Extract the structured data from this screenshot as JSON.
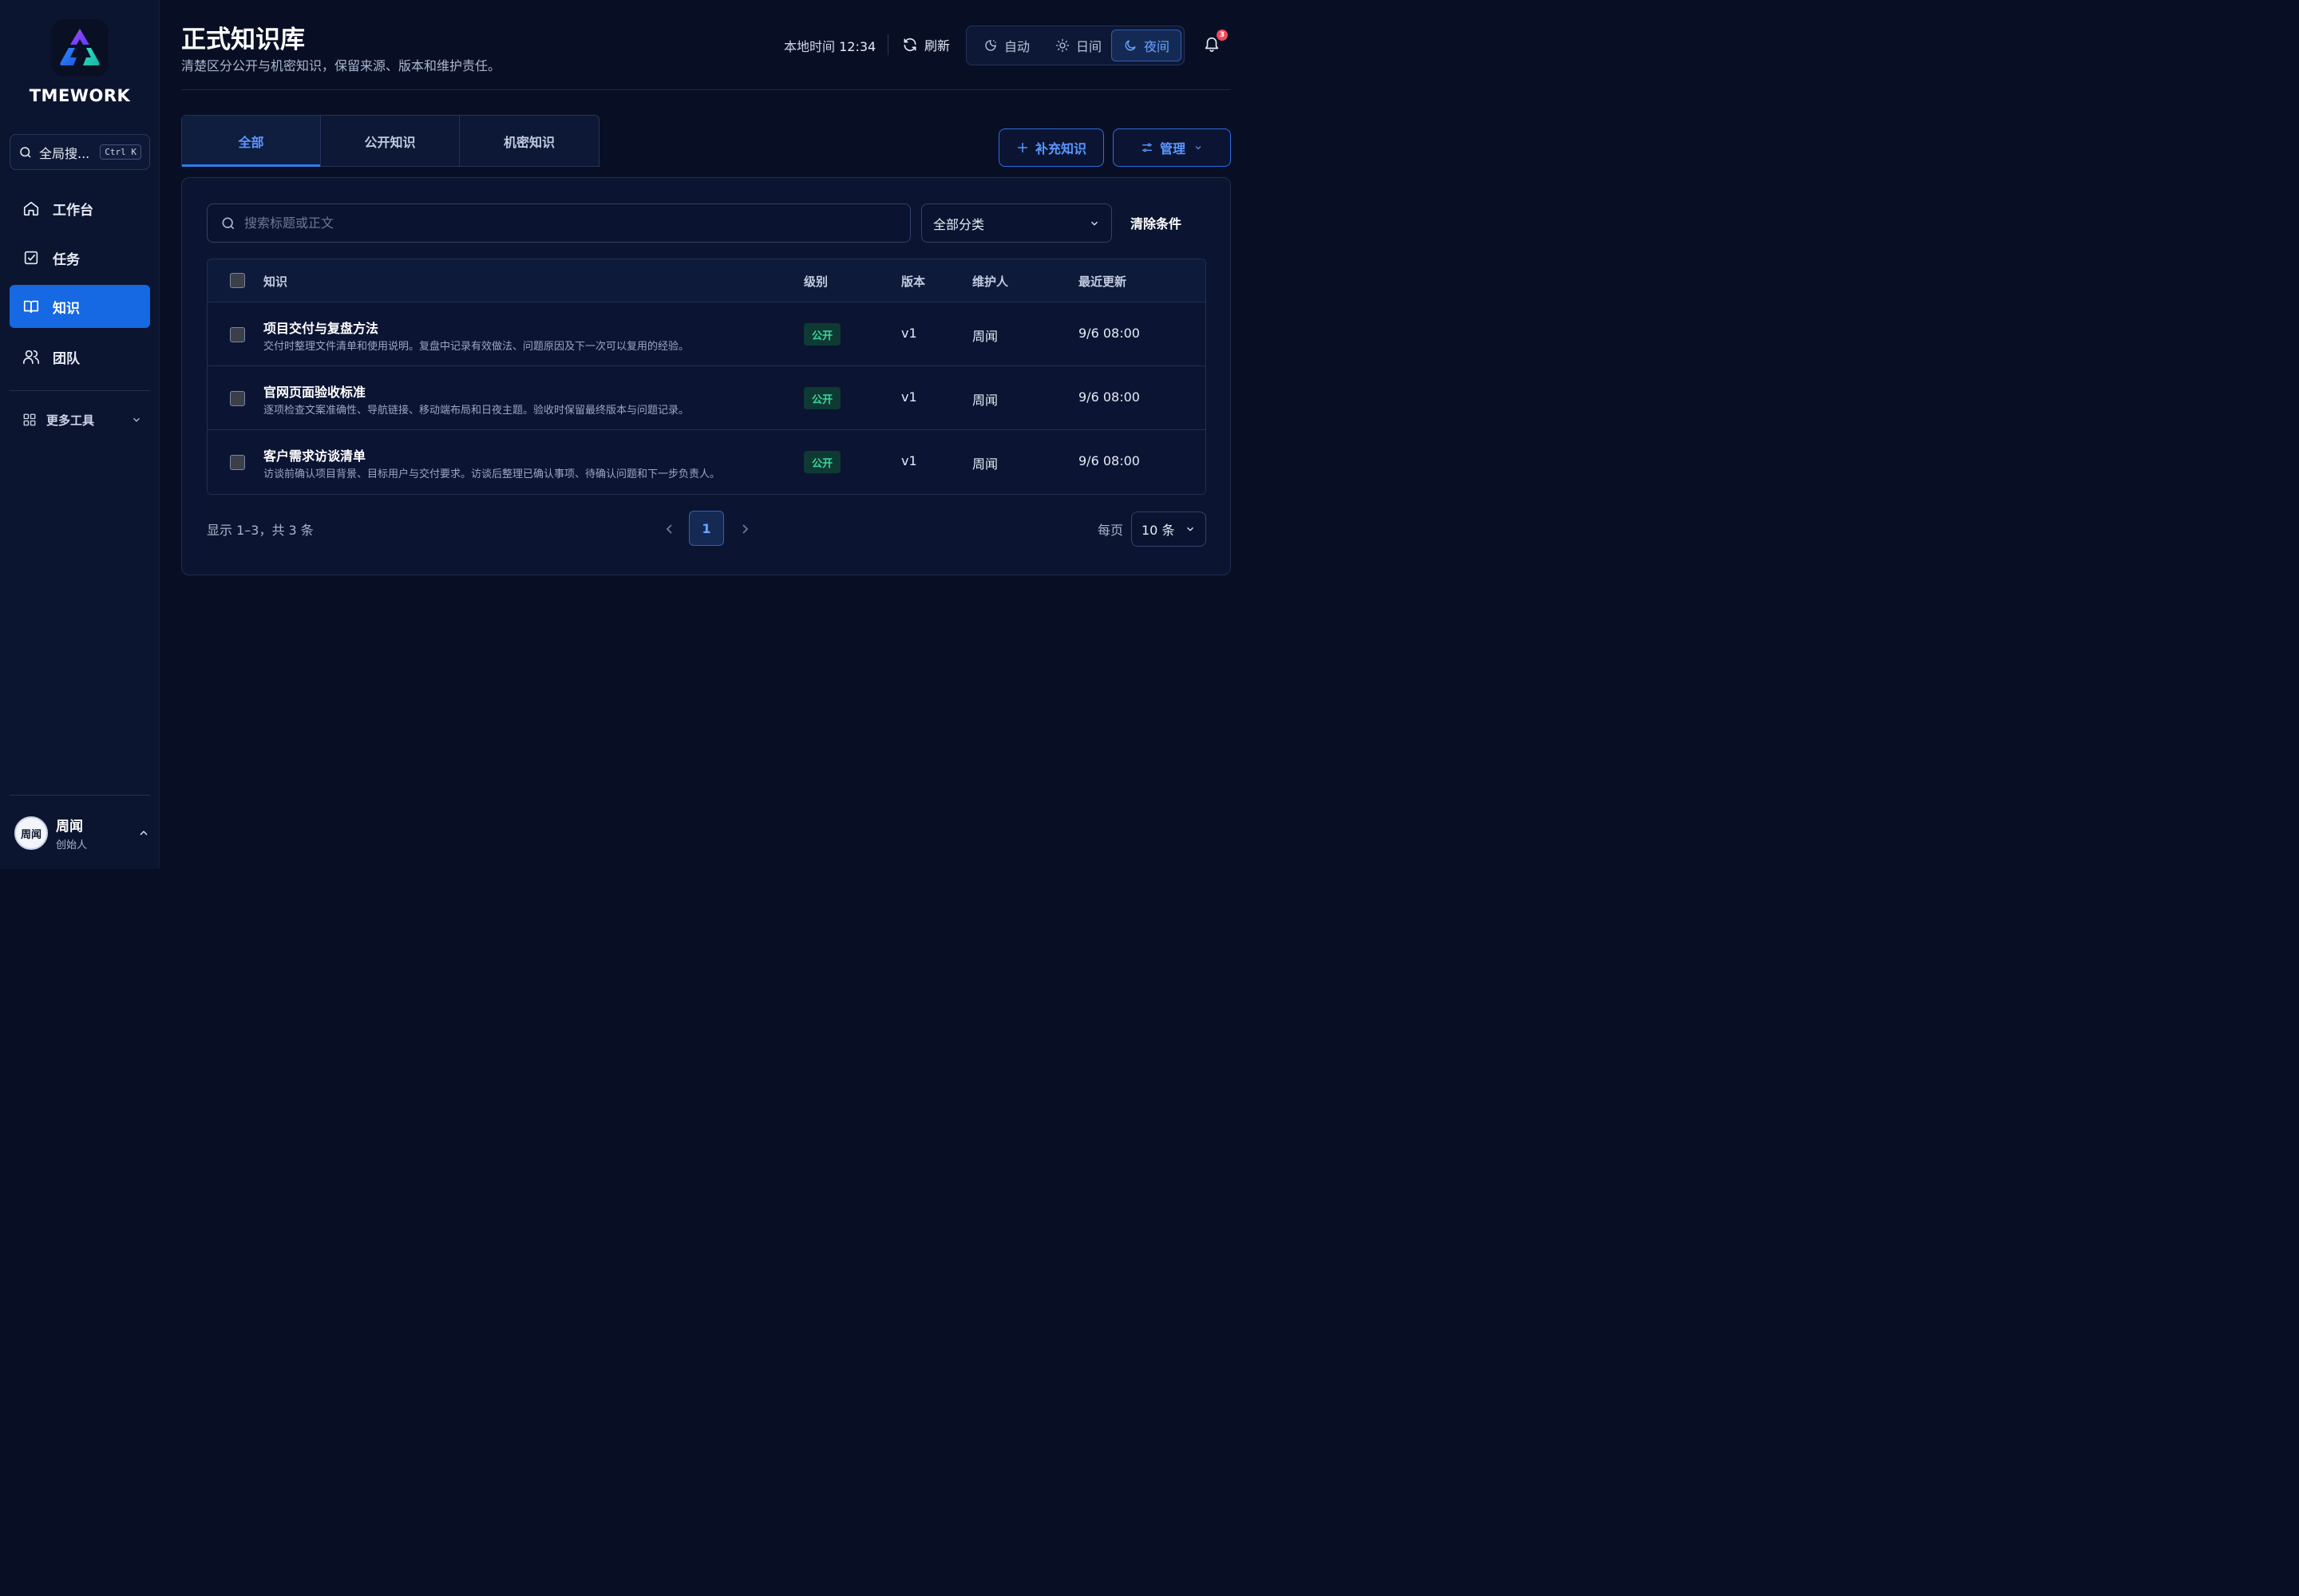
{
  "brand": {
    "name": "TMEWORK"
  },
  "global_search": {
    "placeholder": "全局搜...",
    "shortcut": "Ctrl K"
  },
  "sidebar": {
    "items": [
      {
        "label": "工作台",
        "icon": "home-icon"
      },
      {
        "label": "任务",
        "icon": "checkbox-icon"
      },
      {
        "label": "知识",
        "icon": "book-icon",
        "active": true
      },
      {
        "label": "团队",
        "icon": "users-icon"
      }
    ],
    "more_tools": "更多工具"
  },
  "user": {
    "name": "周闻",
    "role": "创始人",
    "avatar_text": "周闻"
  },
  "header": {
    "title": "正式知识库",
    "subtitle": "清楚区分公开与机密知识，保留来源、版本和维护责任。",
    "clock_label": "本地时间",
    "clock_time": "12:34",
    "refresh_label": "刷新",
    "themes": [
      {
        "label": "自动",
        "icon": "auto-theme-icon"
      },
      {
        "label": "日间",
        "icon": "sun-icon"
      },
      {
        "label": "夜间",
        "icon": "moon-icon",
        "active": true
      }
    ],
    "notification_count": "3"
  },
  "tabs": [
    {
      "label": "全部",
      "active": true
    },
    {
      "label": "公开知识"
    },
    {
      "label": "机密知识"
    }
  ],
  "actions": {
    "add_label": "补充知识",
    "manage_label": "管理"
  },
  "filters": {
    "search_placeholder": "搜索标题或正文",
    "category_value": "全部分类",
    "clear_label": "清除条件"
  },
  "table": {
    "columns": [
      "知识",
      "级别",
      "版本",
      "维护人",
      "最近更新"
    ],
    "rows": [
      {
        "title": "项目交付与复盘方法",
        "desc": "交付时整理文件清单和使用说明。复盘中记录有效做法、问题原因及下一次可以复用的经验。",
        "level": "公开",
        "version": "v1",
        "maintainer": "周闻",
        "updated": "9/6 08:00"
      },
      {
        "title": "官网页面验收标准",
        "desc": "逐项检查文案准确性、导航链接、移动端布局和日夜主题。验收时保留最终版本与问题记录。",
        "level": "公开",
        "version": "v1",
        "maintainer": "周闻",
        "updated": "9/6 08:00"
      },
      {
        "title": "客户需求访谈清单",
        "desc": "访谈前确认项目背景、目标用户与交付要求。访谈后整理已确认事项、待确认问题和下一步负责人。",
        "level": "公开",
        "version": "v1",
        "maintainer": "周闻",
        "updated": "9/6 08:00"
      }
    ]
  },
  "pagination": {
    "info": "显示 1–3，共 3 条",
    "current_page": "1",
    "per_page_label": "每页",
    "per_page_value": "10 条"
  },
  "colors": {
    "accent": "#1668e3",
    "background": "#080f24",
    "public_badge": "#3bd69a"
  }
}
